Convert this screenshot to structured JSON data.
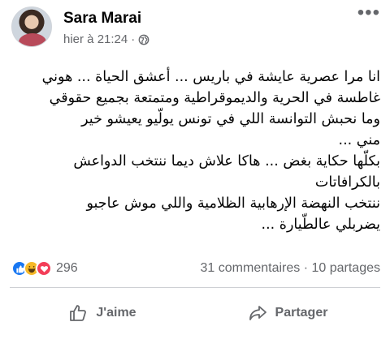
{
  "post": {
    "author": "Sara Marai",
    "timestamp": "hier à 21:24",
    "separator": "·",
    "more_label": "•••",
    "privacy_icon": "globe-icon",
    "lines": [
      "انا مرا عصرية عايشة في باريس ... أعشق الحياة ... هوني",
      "غاطسة في الحرية والديموقراطية ومتمتعة بجميع حقوقي",
      "وما نحبش التوانسة اللي في تونس يولّيو يعيشو خير",
      "مني ...",
      "بكلّها حكاية بغض ... هاكا علاش ديما ننتخب الدواعش",
      "بالكرافاتات",
      "ننتخب النهضة الإرهابية الظلامية واللي موش عاجبو",
      "يضربلي عالطّيارة ..."
    ]
  },
  "stats": {
    "reaction_icons": [
      "like-icon",
      "haha-icon",
      "love-icon"
    ],
    "reaction_count": "296",
    "comments": "31 commentaires",
    "dot": "·",
    "shares": "10 partages"
  },
  "actions": {
    "like_label": "J'aime",
    "share_label": "Partager"
  },
  "colors": {
    "like_blue": "#1877f2",
    "haha_yellow": "#f7b928",
    "love_red": "#f33e58",
    "secondary_text": "#65676b"
  }
}
